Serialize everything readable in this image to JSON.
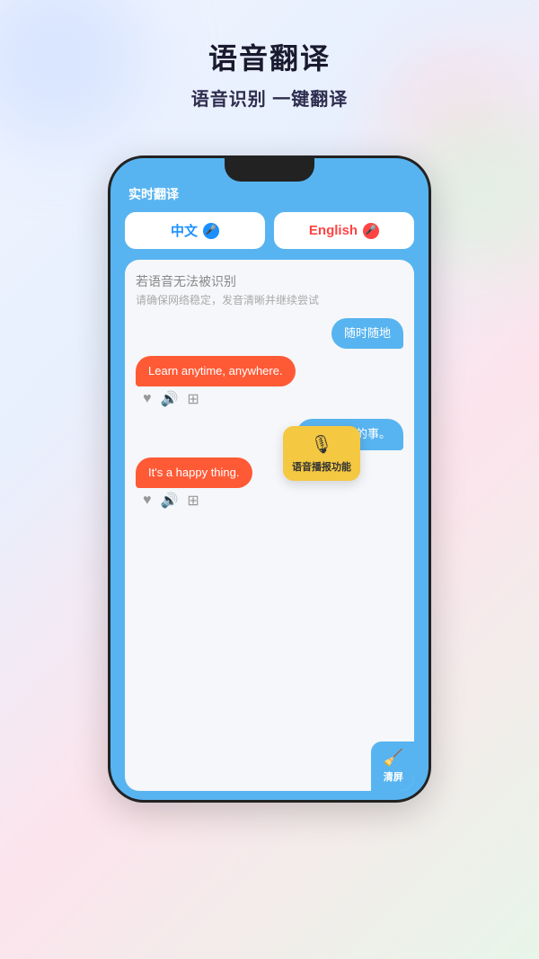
{
  "header": {
    "main_title": "语音翻译",
    "sub_title": "语音识别 一键翻译"
  },
  "phone": {
    "app_title": "实时翻译",
    "lang_chinese": "中文",
    "lang_english": "English",
    "error_main": "若语音无法被识别",
    "error_sub": "请确保网络稳定，发音清晰并继续尝试",
    "msg1_right": "随时随地",
    "msg1_left": "Learn anytime, anywhere.",
    "msg2_right": "一件快乐的事。",
    "msg2_left": "It's a happy thing.",
    "tooltip_text": "语音播报功能",
    "clear_text": "清屏"
  }
}
